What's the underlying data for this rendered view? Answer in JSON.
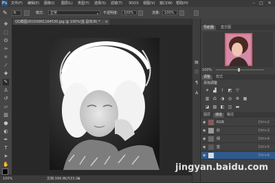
{
  "app": {
    "logo": "Ps"
  },
  "menu": {
    "items": [
      "文件(F)",
      "编辑(E)",
      "图像(I)",
      "图层(L)",
      "类型(Y)",
      "选择(S)",
      "滤镜(T)",
      "3D(D)",
      "视图(V)",
      "窗口(W)",
      "帮助(H)"
    ]
  },
  "window_controls": {
    "minimize": "–",
    "maximize": "□",
    "close": "✕"
  },
  "options_bar": {
    "brush_size": "6",
    "mode_label": "模式:",
    "mode_value": "正常",
    "opacity_label": "不透明度:",
    "opacity_value": "100%",
    "flow_label": "流量:",
    "flow_value": "100%"
  },
  "document": {
    "tab_label": "QQ截图20150901164530.jpg @ 100%(蓝 副本/8) *",
    "tab_close": "×"
  },
  "status": {
    "zoom": "100%",
    "doc_info": "文档:399.8K/533.0K"
  },
  "navigator": {
    "tabs": [
      "导航器",
      "直方图"
    ],
    "zoom": "100%"
  },
  "adjustments": {
    "tabs": [
      "调整",
      "样式"
    ],
    "title": "添加调整"
  },
  "layers": {
    "tabs": [
      "图层",
      "通道",
      "路径"
    ],
    "rows": [
      {
        "name": "RGB",
        "shortcut": "Ctrl+2"
      },
      {
        "name": "红",
        "shortcut": "Ctrl+3"
      },
      {
        "name": "绿",
        "shortcut": "Ctrl+4"
      },
      {
        "name": "蓝",
        "shortcut": "Ctrl+5"
      },
      {
        "name": "",
        "shortcut": "Ctrl+6"
      }
    ]
  },
  "watermark": "jingyan.baidu.com"
}
